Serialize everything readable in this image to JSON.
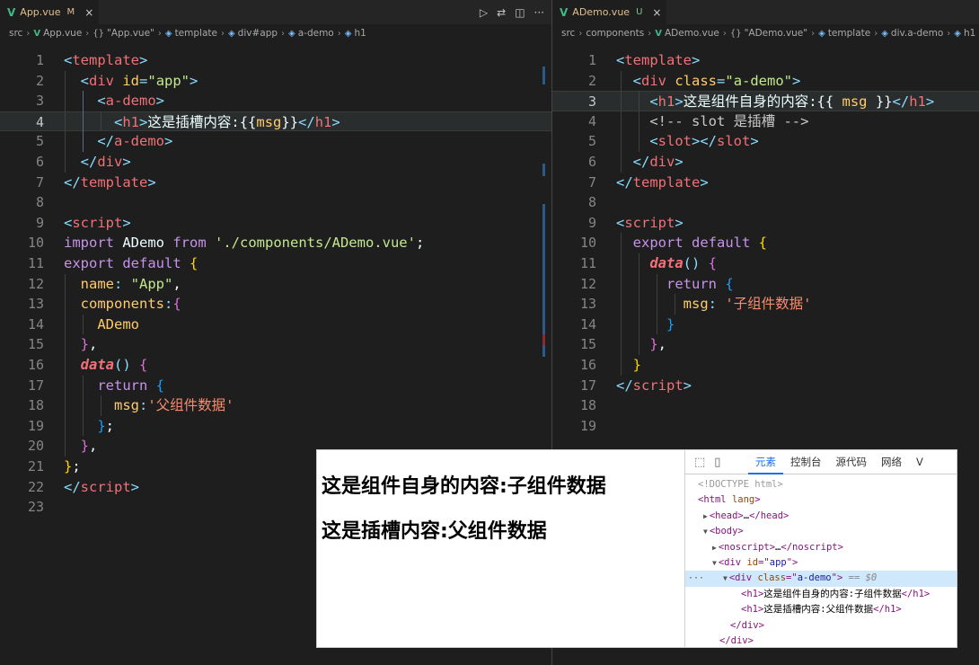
{
  "left_editor": {
    "tab": {
      "icon": "vue-icon",
      "name": "App.vue",
      "status": "M",
      "close": "×"
    },
    "actions": [
      "play-icon",
      "compare-icon",
      "split-editor-icon",
      "more-icon"
    ],
    "action_glyphs": [
      "▷",
      "⇄",
      "◫",
      "···"
    ],
    "breadcrumb": [
      {
        "text": "src",
        "icon": ""
      },
      {
        "text": "App.vue",
        "icon": "vue"
      },
      {
        "text": "\"App.vue\"",
        "icon": "braces"
      },
      {
        "text": "template",
        "icon": "cube"
      },
      {
        "text": "div#app",
        "icon": "cube"
      },
      {
        "text": "a-demo",
        "icon": "cube"
      },
      {
        "text": "h1",
        "icon": "cube"
      }
    ],
    "current_line": 4,
    "lines": [
      [
        [
          "t-punc",
          "<"
        ],
        [
          "t-tag",
          "template"
        ],
        [
          "t-punc",
          ">"
        ]
      ],
      [
        [
          "t-plain",
          "  "
        ],
        [
          "t-punc",
          "<"
        ],
        [
          "t-tag",
          "div "
        ],
        [
          "t-attr",
          "id"
        ],
        [
          "t-punc",
          "="
        ],
        [
          "t-str",
          "\"app\""
        ],
        [
          "t-punc",
          ">"
        ]
      ],
      [
        [
          "t-plain",
          "    "
        ],
        [
          "t-punc",
          "<"
        ],
        [
          "t-tag",
          "a-demo"
        ],
        [
          "t-punc",
          ">"
        ]
      ],
      [
        [
          "t-plain",
          "      "
        ],
        [
          "t-punc",
          "<"
        ],
        [
          "t-tag",
          "h1"
        ],
        [
          "t-punc",
          ">"
        ],
        [
          "t-text",
          "这是插槽内容:{{"
        ],
        [
          "t-attr",
          "msg"
        ],
        [
          "t-text",
          "}}"
        ],
        [
          "t-punc",
          "</"
        ],
        [
          "t-tag",
          "h1"
        ],
        [
          "t-punc",
          ">"
        ]
      ],
      [
        [
          "t-plain",
          "    "
        ],
        [
          "t-punc",
          "</"
        ],
        [
          "t-tag",
          "a-demo"
        ],
        [
          "t-punc",
          ">"
        ]
      ],
      [
        [
          "t-plain",
          "  "
        ],
        [
          "t-punc",
          "</"
        ],
        [
          "t-tag",
          "div"
        ],
        [
          "t-punc",
          ">"
        ]
      ],
      [
        [
          "t-punc",
          "</"
        ],
        [
          "t-tag",
          "template"
        ],
        [
          "t-punc",
          ">"
        ]
      ],
      [],
      [
        [
          "t-punc",
          "<"
        ],
        [
          "t-tag",
          "script"
        ],
        [
          "t-punc",
          ">"
        ]
      ],
      [
        [
          "t-kw",
          "import "
        ],
        [
          "t-plain",
          "ADemo "
        ],
        [
          "t-kw",
          "from "
        ],
        [
          "t-str",
          "'./components/ADemo.vue'"
        ],
        [
          "t-plain",
          ";"
        ]
      ],
      [
        [
          "t-kw",
          "export default "
        ],
        [
          "t-brace-y",
          "{"
        ]
      ],
      [
        [
          "t-plain",
          "  "
        ],
        [
          "t-attr",
          "name"
        ],
        [
          "t-punc",
          ": "
        ],
        [
          "t-str",
          "\"App\""
        ],
        [
          "t-plain",
          ","
        ]
      ],
      [
        [
          "t-plain",
          "  "
        ],
        [
          "t-attr",
          "components"
        ],
        [
          "t-punc",
          ":"
        ],
        [
          "t-brace-p",
          "{"
        ]
      ],
      [
        [
          "t-plain",
          "    "
        ],
        [
          "t-attr",
          "ADemo"
        ]
      ],
      [
        [
          "t-plain",
          "  "
        ],
        [
          "t-brace-p",
          "}"
        ],
        [
          "t-plain",
          ","
        ]
      ],
      [
        [
          "t-plain",
          "  "
        ],
        [
          "t-fn",
          "data"
        ],
        [
          "t-punc",
          "() "
        ],
        [
          "t-brace-p",
          "{"
        ]
      ],
      [
        [
          "t-plain",
          "    "
        ],
        [
          "t-kw",
          "return "
        ],
        [
          "t-brace-b",
          "{"
        ]
      ],
      [
        [
          "t-plain",
          "      "
        ],
        [
          "t-attr",
          "msg"
        ],
        [
          "t-punc",
          ":"
        ],
        [
          "t-str2",
          "'父组件数据'"
        ]
      ],
      [
        [
          "t-plain",
          "    "
        ],
        [
          "t-brace-b",
          "}"
        ],
        [
          "t-plain",
          ";"
        ]
      ],
      [
        [
          "t-plain",
          "  "
        ],
        [
          "t-brace-p",
          "}"
        ],
        [
          "t-plain",
          ","
        ]
      ],
      [
        [
          "t-brace-y",
          "}"
        ],
        [
          "t-plain",
          ";"
        ]
      ],
      [
        [
          "t-punc",
          "</"
        ],
        [
          "t-tag",
          "script"
        ],
        [
          "t-punc",
          ">"
        ]
      ],
      []
    ]
  },
  "right_editor": {
    "tab": {
      "icon": "vue-icon",
      "name": "ADemo.vue",
      "status": "U",
      "close": "×"
    },
    "breadcrumb": [
      {
        "text": "src",
        "icon": ""
      },
      {
        "text": "components",
        "icon": ""
      },
      {
        "text": "ADemo.vue",
        "icon": "vue"
      },
      {
        "text": "\"ADemo.vue\"",
        "icon": "braces"
      },
      {
        "text": "template",
        "icon": "cube"
      },
      {
        "text": "div.a-demo",
        "icon": "cube"
      },
      {
        "text": "h1",
        "icon": "cube"
      }
    ],
    "current_line": 3,
    "lines": [
      [
        [
          "t-punc",
          "<"
        ],
        [
          "t-tag",
          "template"
        ],
        [
          "t-punc",
          ">"
        ]
      ],
      [
        [
          "t-plain",
          "  "
        ],
        [
          "t-punc",
          "<"
        ],
        [
          "t-tag",
          "div "
        ],
        [
          "t-attr",
          "class"
        ],
        [
          "t-punc",
          "="
        ],
        [
          "t-str",
          "\"a-demo\""
        ],
        [
          "t-punc",
          ">"
        ]
      ],
      [
        [
          "t-plain",
          "    "
        ],
        [
          "t-punc",
          "<"
        ],
        [
          "t-tag",
          "h1"
        ],
        [
          "t-punc",
          ">"
        ],
        [
          "t-text",
          "这是组件自身的内容:{{ "
        ],
        [
          "t-attr",
          "msg"
        ],
        [
          "t-text",
          " }}"
        ],
        [
          "t-punc",
          "</"
        ],
        [
          "t-tag",
          "h1"
        ],
        [
          "t-punc",
          ">"
        ]
      ],
      [
        [
          "t-plain",
          "    "
        ],
        [
          "t-comment",
          "<!-- slot 是插槽 -->"
        ]
      ],
      [
        [
          "t-plain",
          "    "
        ],
        [
          "t-punc",
          "<"
        ],
        [
          "t-tag",
          "slot"
        ],
        [
          "t-punc",
          "></"
        ],
        [
          "t-tag",
          "slot"
        ],
        [
          "t-punc",
          ">"
        ]
      ],
      [
        [
          "t-plain",
          "  "
        ],
        [
          "t-punc",
          "</"
        ],
        [
          "t-tag",
          "div"
        ],
        [
          "t-punc",
          ">"
        ]
      ],
      [
        [
          "t-punc",
          "</"
        ],
        [
          "t-tag",
          "template"
        ],
        [
          "t-punc",
          ">"
        ]
      ],
      [],
      [
        [
          "t-punc",
          "<"
        ],
        [
          "t-tag",
          "script"
        ],
        [
          "t-punc",
          ">"
        ]
      ],
      [
        [
          "t-plain",
          "  "
        ],
        [
          "t-kw",
          "export default "
        ],
        [
          "t-brace-y",
          "{"
        ]
      ],
      [
        [
          "t-plain",
          "    "
        ],
        [
          "t-fn",
          "data"
        ],
        [
          "t-punc",
          "() "
        ],
        [
          "t-brace-p",
          "{"
        ]
      ],
      [
        [
          "t-plain",
          "      "
        ],
        [
          "t-kw",
          "return "
        ],
        [
          "t-brace-b",
          "{"
        ]
      ],
      [
        [
          "t-plain",
          "        "
        ],
        [
          "t-attr",
          "msg"
        ],
        [
          "t-punc",
          ": "
        ],
        [
          "t-str2",
          "'子组件数据'"
        ]
      ],
      [
        [
          "t-plain",
          "      "
        ],
        [
          "t-brace-b",
          "}"
        ]
      ],
      [
        [
          "t-plain",
          "    "
        ],
        [
          "t-brace-p",
          "}"
        ],
        [
          "t-plain",
          ","
        ]
      ],
      [
        [
          "t-plain",
          "  "
        ],
        [
          "t-brace-y",
          "}"
        ]
      ],
      [
        [
          "t-punc",
          "</"
        ],
        [
          "t-tag",
          "script"
        ],
        [
          "t-punc",
          ">"
        ]
      ],
      [],
      []
    ]
  },
  "browser": {
    "rendered": [
      "这是组件自身的内容:子组件数据",
      "这是插槽内容:父组件数据"
    ],
    "devtools": {
      "inspect_icon": "⬚",
      "device_icon": "▯",
      "tabs": [
        "元素",
        "控制台",
        "源代码",
        "网络",
        "V"
      ],
      "active_tab": 0,
      "ellipsis": "···",
      "tree": [
        [
          [
            "dt-doctype",
            "<!DOCTYPE html>"
          ]
        ],
        [
          [
            "dt-tag",
            "<html "
          ],
          [
            "dt-attr",
            "lang"
          ],
          [
            "dt-tag",
            ">"
          ]
        ],
        [
          [
            "dt-arrow",
            "▶"
          ],
          [
            "dt-tag",
            "<head>"
          ],
          [
            "dt-text",
            "…"
          ],
          [
            "dt-tag",
            "</head>"
          ]
        ],
        [
          [
            "dt-arrow",
            "▼"
          ],
          [
            "dt-tag",
            "<body>"
          ]
        ],
        [
          [
            "dt-arrow",
            "▶"
          ],
          [
            "dt-tag",
            "<noscript>"
          ],
          [
            "dt-text",
            "…"
          ],
          [
            "dt-tag",
            "</noscript>"
          ]
        ],
        [
          [
            "dt-arrow",
            "▼"
          ],
          [
            "dt-tag",
            "<div "
          ],
          [
            "dt-attr",
            "id"
          ],
          [
            "dt-tag",
            "=\""
          ],
          [
            "dt-val",
            "app"
          ],
          [
            "dt-tag",
            "\">"
          ]
        ],
        [
          [
            "dt-arrow",
            "▼"
          ],
          [
            "dt-tag",
            "<div "
          ],
          [
            "dt-attr",
            "class"
          ],
          [
            "dt-tag",
            "=\""
          ],
          [
            "dt-val",
            "a-demo"
          ],
          [
            "dt-tag",
            "\">"
          ],
          [
            "dt-eq",
            " == $0"
          ]
        ],
        [
          [
            "dt-tag",
            "<h1>"
          ],
          [
            "dt-text",
            "这是组件自身的内容:子组件数据"
          ],
          [
            "dt-tag",
            "</h1>"
          ]
        ],
        [
          [
            "dt-tag",
            "<h1>"
          ],
          [
            "dt-text",
            "这是插槽内容:父组件数据"
          ],
          [
            "dt-tag",
            "</h1>"
          ]
        ],
        [
          [
            "dt-tag",
            "</div>"
          ]
        ],
        [
          [
            "dt-tag",
            "</div>"
          ]
        ]
      ],
      "selected_row": 6
    }
  }
}
